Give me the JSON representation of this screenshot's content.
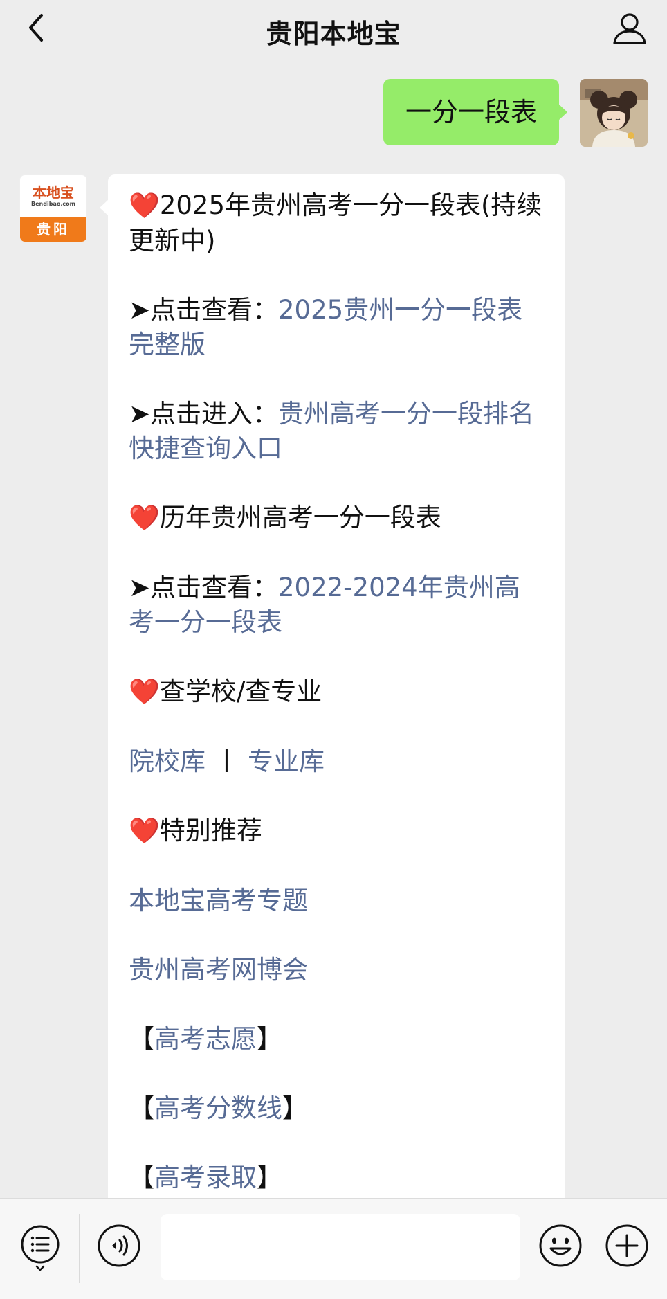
{
  "header": {
    "title": "贵阳本地宝",
    "back_icon": "chevron-left-icon",
    "profile_icon": "person-icon"
  },
  "messages": {
    "outgoing": {
      "text": "一分一段表"
    },
    "incoming": {
      "sender_logo": {
        "name": "本地宝",
        "domain": "Bendibao.com",
        "city": "贵阳"
      },
      "section1_heart": "❤️",
      "section1_title": "2025年贵州高考一分一段表(持续更新中)",
      "line1_prefix": "➤点击查看：",
      "line1_link": "2025贵州一分一段表完整版",
      "line2_prefix": "➤点击进入：",
      "line2_link": "贵州高考一分一段排名快捷查询入口",
      "section2_heart": "❤️",
      "section2_title": "历年贵州高考一分一段表",
      "line3_prefix": "➤点击查看：",
      "line3_link": "2022-2024年贵州高考一分一段表",
      "section3_heart": "❤️",
      "section3_title": "查学校/查专业",
      "link_school": "院校库",
      "separator": "丨",
      "link_major": "专业库",
      "section4_heart": "❤️",
      "section4_title": "特别推荐",
      "link_topic": "本地宝高考专题",
      "link_fair": "贵州高考网博会",
      "bracket_open": "【",
      "bracket_close": "】",
      "link_volunteer": "高考志愿",
      "link_scoreline": "高考分数线",
      "link_admission": "高考录取"
    }
  },
  "input_bar": {
    "menu_icon": "menu-list-icon",
    "voice_icon": "voice-icon",
    "input_value": "",
    "emoji_icon": "emoji-icon",
    "plus_icon": "plus-icon"
  },
  "colors": {
    "link": "#576b95",
    "outgoing_bubble": "#95ec69",
    "background": "#ededed",
    "logo_orange": "#f07a1a"
  }
}
